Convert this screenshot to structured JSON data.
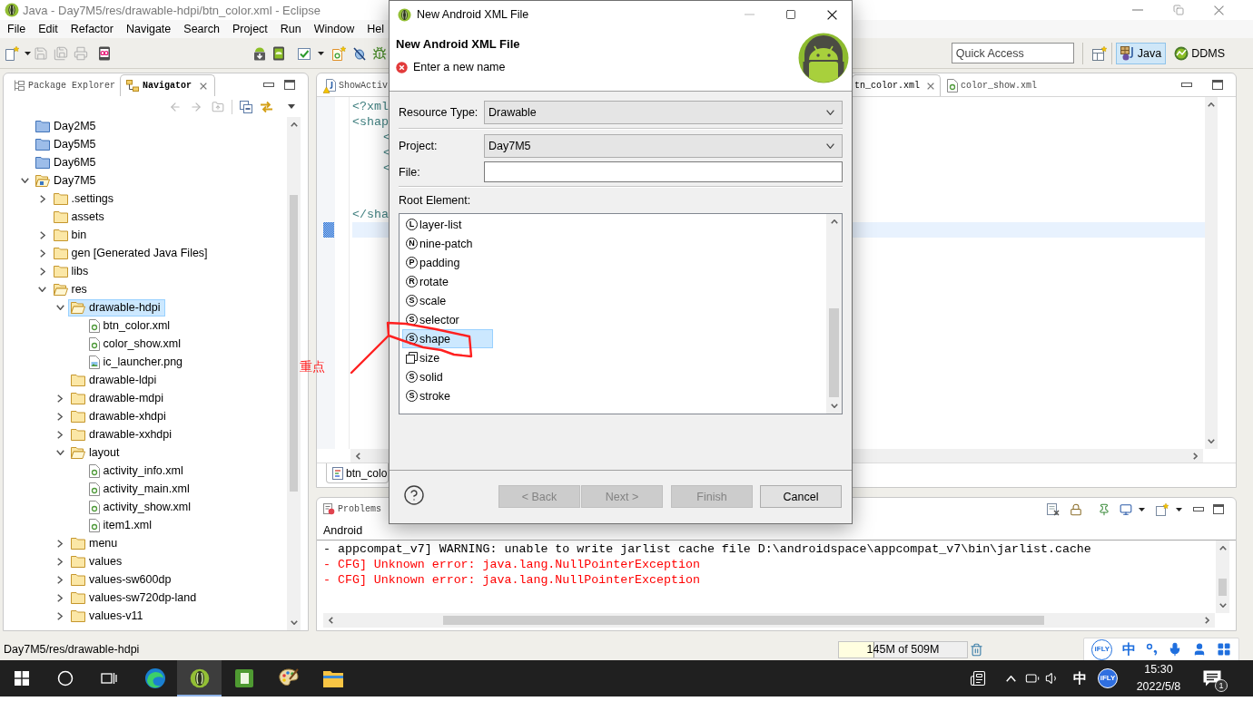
{
  "window": {
    "title": "Java - Day7M5/res/drawable-hdpi/btn_color.xml - Eclipse"
  },
  "menu": [
    "File",
    "Edit",
    "Refactor",
    "Navigate",
    "Search",
    "Project",
    "Run",
    "Window",
    "Hel"
  ],
  "toolbar": {
    "quick_access": {
      "placeholder": "Quick Access"
    },
    "perspectives": [
      {
        "label": "Java",
        "kind": "java",
        "selected": true
      },
      {
        "label": "DDMS",
        "kind": "ddms",
        "selected": false
      }
    ]
  },
  "left_panel": {
    "tabs": [
      {
        "label": "Package Explorer",
        "kind": "packages",
        "selected": false
      },
      {
        "label": "Navigator",
        "kind": "navigator",
        "selected": true
      }
    ],
    "tree": [
      {
        "label": "Day2M5",
        "kind": "closed-project",
        "expandable": false,
        "expanded": false,
        "selected": false
      },
      {
        "label": "Day5M5",
        "kind": "closed-project",
        "expandable": false,
        "expanded": false,
        "selected": false
      },
      {
        "label": "Day6M5",
        "kind": "closed-project",
        "expandable": false,
        "expanded": false,
        "selected": false
      },
      {
        "label": "Day7M5",
        "kind": "project",
        "expandable": true,
        "expanded": true,
        "selected": false,
        "children": [
          {
            "label": ".settings",
            "kind": "folder",
            "expandable": true,
            "expanded": false,
            "selected": false
          },
          {
            "label": "assets",
            "kind": "folder",
            "expandable": false,
            "expanded": false,
            "selected": false
          },
          {
            "label": "bin",
            "kind": "folder",
            "expandable": true,
            "expanded": false,
            "selected": false
          },
          {
            "label": "gen [Generated Java Files]",
            "kind": "folder",
            "expandable": true,
            "expanded": false,
            "selected": false
          },
          {
            "label": "libs",
            "kind": "folder",
            "expandable": true,
            "expanded": false,
            "selected": false
          },
          {
            "label": "res",
            "kind": "folder",
            "expandable": true,
            "expanded": true,
            "selected": false,
            "children": [
              {
                "label": "drawable-hdpi",
                "kind": "folder",
                "expandable": true,
                "expanded": true,
                "selected": true,
                "children": [
                  {
                    "label": "btn_color.xml",
                    "kind": "xml",
                    "expandable": false,
                    "expanded": false,
                    "selected": false
                  },
                  {
                    "label": "color_show.xml",
                    "kind": "xml",
                    "expandable": false,
                    "expanded": false,
                    "selected": false
                  },
                  {
                    "label": "ic_launcher.png",
                    "kind": "image",
                    "expandable": false,
                    "expanded": false,
                    "selected": false
                  }
                ]
              },
              {
                "label": "drawable-ldpi",
                "kind": "folder",
                "expandable": false,
                "expanded": false,
                "selected": false
              },
              {
                "label": "drawable-mdpi",
                "kind": "folder",
                "expandable": true,
                "expanded": false,
                "selected": false
              },
              {
                "label": "drawable-xhdpi",
                "kind": "folder",
                "expandable": true,
                "expanded": false,
                "selected": false
              },
              {
                "label": "drawable-xxhdpi",
                "kind": "folder",
                "expandable": true,
                "expanded": false,
                "selected": false
              },
              {
                "label": "layout",
                "kind": "folder",
                "expandable": true,
                "expanded": true,
                "selected": false,
                "children": [
                  {
                    "label": "activity_info.xml",
                    "kind": "xml",
                    "expandable": false,
                    "expanded": false,
                    "selected": false
                  },
                  {
                    "label": "activity_main.xml",
                    "kind": "xml",
                    "expandable": false,
                    "expanded": false,
                    "selected": false
                  },
                  {
                    "label": "activity_show.xml",
                    "kind": "xml",
                    "expandable": false,
                    "expanded": false,
                    "selected": false
                  },
                  {
                    "label": "item1.xml",
                    "kind": "xml",
                    "expandable": false,
                    "expanded": false,
                    "selected": false
                  }
                ]
              },
              {
                "label": "menu",
                "kind": "folder",
                "expandable": true,
                "expanded": false,
                "selected": false
              },
              {
                "label": "values",
                "kind": "folder",
                "expandable": true,
                "expanded": false,
                "selected": false
              },
              {
                "label": "values-sw600dp",
                "kind": "folder",
                "expandable": true,
                "expanded": false,
                "selected": false
              },
              {
                "label": "values-sw720dp-land",
                "kind": "folder",
                "expandable": true,
                "expanded": false,
                "selected": false
              },
              {
                "label": "values-v11",
                "kind": "folder",
                "expandable": true,
                "expanded": false,
                "selected": false
              }
            ]
          }
        ]
      }
    ]
  },
  "editor": {
    "tabs": [
      {
        "label": "ShowActiv",
        "kind": "java",
        "selected": false
      },
      {
        "label": "tn_color.xml",
        "selected": true
      },
      {
        "label": "color_show.xml",
        "kind": "xml",
        "selected": false
      }
    ],
    "code": [
      {
        "text": "<?xml"
      },
      {
        "text": "<shap",
        "children": [
          {
            "text": "<"
          },
          {
            "text": "<"
          },
          {
            "text": "<"
          }
        ]
      },
      {
        "text": "</sha"
      }
    ],
    "bottom_tab": "btn_colo"
  },
  "console": {
    "tab": "Problems",
    "title": "Android",
    "lines": [
      {
        "text": "- appcompat_v7] WARNING: unable to write jarlist cache file D:\\androidspace\\appcompat_v7\\bin\\jarlist.cache",
        "color": "#000000"
      },
      {
        "text": "- CFG] Unknown error: java.lang.NullPointerException",
        "color": "#ff0000"
      },
      {
        "text": "- CFG] Unknown error: java.lang.NullPointerException",
        "color": "#ff0000"
      }
    ]
  },
  "status_bar": {
    "path": "Day7M5/res/drawable-hdpi",
    "heap": {
      "text": "145M of 509M",
      "level": 0.28
    }
  },
  "ime_bar": {
    "logo": "iFLY",
    "mode": "中"
  },
  "dialog": {
    "title": "New Android XML File",
    "heading": "New Android XML File",
    "message": "Enter a new name",
    "fields": [
      {
        "label": "Resource Type:",
        "kind": "dropdown",
        "value": "Drawable"
      },
      {
        "label": "Project:",
        "kind": "dropdown",
        "value": "Day7M5"
      },
      {
        "label": "File:",
        "kind": "text"
      }
    ],
    "root_label": "Root Element:",
    "root_elements": [
      {
        "label": "layer-list",
        "kind": "letter",
        "letter": "L",
        "selected": false
      },
      {
        "label": "nine-patch",
        "kind": "letter",
        "letter": "N",
        "selected": false
      },
      {
        "label": "padding",
        "kind": "letter",
        "letter": "P",
        "selected": false
      },
      {
        "label": "rotate",
        "kind": "letter",
        "letter": "R",
        "selected": false
      },
      {
        "label": "scale",
        "kind": "letter",
        "letter": "S",
        "selected": false
      },
      {
        "label": "selector",
        "kind": "letter",
        "letter": "S",
        "selected": false
      },
      {
        "label": "shape",
        "kind": "letter",
        "letter": "S",
        "selected": true
      },
      {
        "label": "size",
        "kind": "box",
        "selected": false
      },
      {
        "label": "solid",
        "kind": "letter",
        "letter": "S",
        "selected": false
      },
      {
        "label": "stroke",
        "kind": "letter",
        "letter": "S",
        "selected": false
      }
    ],
    "buttons": [
      {
        "label": "< Back",
        "disabled": true
      },
      {
        "label": "Next >",
        "disabled": true
      },
      {
        "label": "Finish",
        "disabled": true
      },
      {
        "label": "Cancel",
        "disabled": false
      }
    ]
  },
  "annotation": {
    "text": "重点"
  },
  "taskbar": {
    "apps": [
      {
        "kind": "browser",
        "selected": false
      },
      {
        "kind": "eclipse",
        "selected": true
      },
      {
        "kind": "app",
        "selected": false
      },
      {
        "kind": "paint",
        "selected": false
      },
      {
        "kind": "explorer",
        "selected": false
      }
    ],
    "tray": {
      "ime": "中",
      "logo": "iFLY",
      "time": "15:30",
      "date": "2022/5/8",
      "notifications": "1"
    }
  }
}
